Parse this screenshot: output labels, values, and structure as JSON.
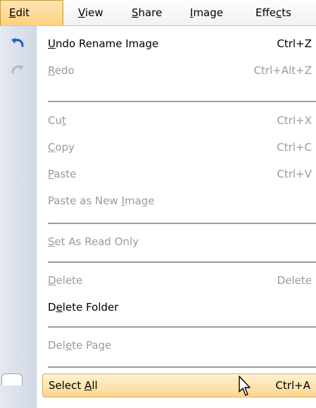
{
  "menubar": {
    "items": [
      {
        "pre": "",
        "mnem": "E",
        "post": "dit",
        "active": true
      },
      {
        "pre": "",
        "mnem": "V",
        "post": "iew"
      },
      {
        "pre": "",
        "mnem": "S",
        "post": "hare"
      },
      {
        "pre": "",
        "mnem": "I",
        "post": "mage"
      },
      {
        "pre": "Effe",
        "mnem": "c",
        "post": "ts"
      }
    ]
  },
  "menu": {
    "undo": {
      "pre": "",
      "mnem": "U",
      "post": "ndo Rename Image",
      "shortcut": "Ctrl+Z",
      "enabled": true
    },
    "redo": {
      "pre": "",
      "mnem": "R",
      "post": "edo",
      "shortcut": "Ctrl+Alt+Z",
      "enabled": false
    },
    "cut": {
      "pre": "Cu",
      "mnem": "t",
      "post": "",
      "shortcut": "Ctrl+X",
      "enabled": false
    },
    "copy": {
      "pre": "",
      "mnem": "C",
      "post": "opy",
      "shortcut": "Ctrl+C",
      "enabled": false
    },
    "paste": {
      "pre": "",
      "mnem": "P",
      "post": "aste",
      "shortcut": "Ctrl+V",
      "enabled": false
    },
    "paste_new_image": {
      "pre": "Paste as New ",
      "mnem": "I",
      "post": "mage",
      "shortcut": "",
      "enabled": false
    },
    "set_read_only": {
      "pre": "",
      "mnem": "S",
      "post": "et As Read Only",
      "shortcut": "",
      "enabled": false
    },
    "delete": {
      "pre": "",
      "mnem": "D",
      "post": "elete",
      "shortcut": "Delete",
      "enabled": false
    },
    "delete_folder": {
      "pre": "D",
      "mnem": "e",
      "post": "lete Folder",
      "shortcut": "",
      "enabled": true
    },
    "delete_page": {
      "pre": "Del",
      "mnem": "e",
      "post": "te Page",
      "shortcut": "",
      "enabled": false
    },
    "select_all": {
      "pre": "Select ",
      "mnem": "A",
      "post": "ll",
      "shortcut": "Ctrl+A",
      "enabled": true,
      "highlighted": true
    }
  },
  "icons": {
    "undo": "undo-arrow-icon",
    "redo": "redo-arrow-icon",
    "cursor": "mouse-pointer-icon"
  },
  "colors": {
    "highlight": "#ffd68e",
    "gutter": "#dde3ec",
    "disabled_text": "#9a9a9a",
    "undo_icon": "#1f5fbf"
  }
}
